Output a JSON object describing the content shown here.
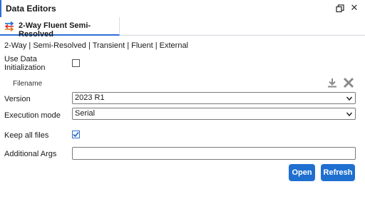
{
  "window": {
    "title": "Data Editors",
    "restore_icon": "restore-window-icon",
    "close_icon": "close-icon",
    "close_glyph": "✕"
  },
  "tab": {
    "label": "2-Way Fluent Semi-Resolved",
    "icon": "coupling-icon"
  },
  "breadcrumb": "2-Way | Semi-Resolved | Transient | Fluent | External",
  "form": {
    "use_data_initialization": {
      "label_line1": "Use Data",
      "label_line2": "Initialization",
      "checked": false
    },
    "filename": {
      "label": "Filename",
      "download_icon": "download-icon",
      "clear_icon": "clear-icon"
    },
    "version": {
      "label": "Version",
      "value": "2023 R1"
    },
    "execution_mode": {
      "label": "Execution mode",
      "value": "Serial"
    },
    "keep_all_files": {
      "label": "Keep all files",
      "checked": true
    },
    "additional_args": {
      "label": "Additional Args",
      "value": ""
    }
  },
  "buttons": {
    "open": "Open",
    "refresh": "Refresh"
  },
  "colors": {
    "accent": "#1f6fd1",
    "tab_underline": "#2b6fd6"
  }
}
